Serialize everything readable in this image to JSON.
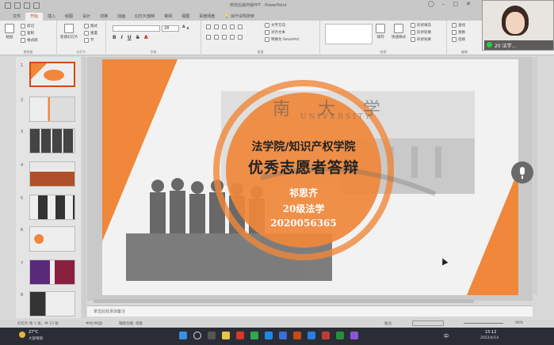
{
  "window": {
    "doc_title": "修改后最终版PPT - PowerPoint",
    "tabs": [
      "文件",
      "开始",
      "插入",
      "绘图",
      "设计",
      "切换",
      "动画",
      "幻灯片放映",
      "审阅",
      "视图",
      "百度网盘"
    ],
    "active_tab_index": 1,
    "search_tab": "操作说明搜索",
    "accent_color": "#c14a14"
  },
  "ribbon": {
    "groups": {
      "clipboard": "剪贴板",
      "slides": "幻灯片",
      "font": "字体",
      "paragraph": "段落",
      "drawing": "绘图",
      "editing": "编辑"
    },
    "paste_label": "粘贴",
    "cut_label": "剪切",
    "copy_label": "复制",
    "format_painter_label": "格式刷",
    "new_slide_label": "新建幻灯片",
    "layout_label": "版式",
    "reset_label": "重置",
    "section_label": "节",
    "font_size": "28",
    "text_direction_label": "文字方向",
    "align_text_label": "对齐文本",
    "smartart_label": "转换为 SmartArt",
    "arrange_label": "排列",
    "quick_styles_label": "快速样式",
    "shape_fill_label": "形状填充",
    "shape_outline_label": "形状轮廓",
    "shape_effects_label": "形状效果",
    "find_label": "查找",
    "replace_label": "替换",
    "select_label": "选择"
  },
  "slides_panel": {
    "numbers": [
      "1",
      "2",
      "3",
      "4",
      "5",
      "6",
      "7",
      "8"
    ],
    "selected_index": 0
  },
  "slide": {
    "title_line1": "法学院/知识产权学院",
    "title_line2": "优秀志愿者答辩",
    "name": "祁思齐",
    "class": "20级法学",
    "student_id": "2020056365",
    "bg_lettering": "南 大 学",
    "bg_english": "UNIVERSITY",
    "orange": "#f0873a",
    "title_color": "#ffffff"
  },
  "notes": {
    "placeholder": "单击此处添加备注"
  },
  "status": {
    "slide_info": "幻灯片 第 1 张，共 13 张",
    "language": "中文(中国)",
    "accessibility": "辅助功能: 调查",
    "notes_button": "备注",
    "zoom": "90%"
  },
  "video": {
    "name_label": "20 法学..."
  },
  "taskbar": {
    "weather_temp": "27°C",
    "weather_desc": "大部晴朗",
    "ime": "中",
    "time": "15:12",
    "date": "2022/4/14"
  }
}
